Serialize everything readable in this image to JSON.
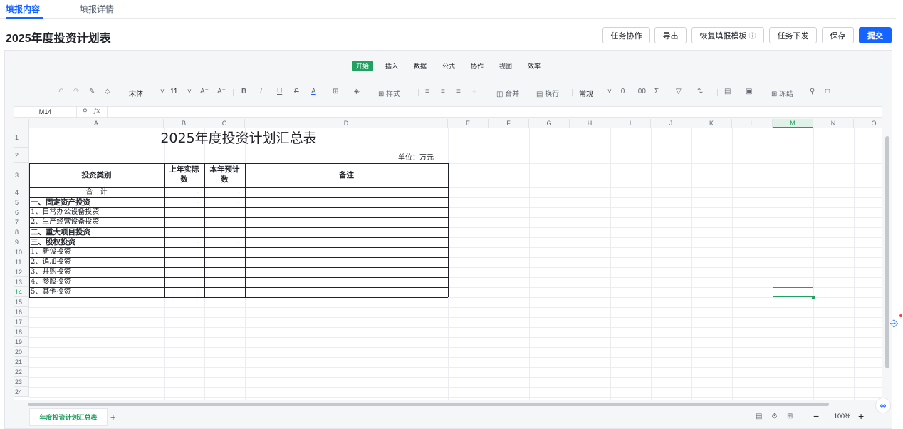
{
  "tabs": [
    {
      "label": "填报内容",
      "active": true
    },
    {
      "label": "填报详情",
      "active": false
    }
  ],
  "page_title": "2025年度投资计划表",
  "header_buttons": {
    "task_collab": "任务协作",
    "export": "导出",
    "restore_template": "恢复填报模板",
    "task_dispatch": "任务下发",
    "save": "保存",
    "submit": "提交"
  },
  "menu_tabs": [
    "开始",
    "插入",
    "数据",
    "公式",
    "协作",
    "视图",
    "效率"
  ],
  "toolbar": {
    "font_name": "宋体",
    "font_size": "11",
    "font_grow": "A⁺",
    "font_shrink": "A⁻",
    "bold": "B",
    "italic": "I",
    "underline": "U",
    "strike": "S",
    "style": "样式",
    "merge": "合并",
    "wrap": "换行",
    "number_format": "常规",
    "freeze": "冻结",
    "font_color": "A"
  },
  "name_box": "M14",
  "formula_icon": "fx",
  "columns": [
    "A",
    "B",
    "C",
    "D",
    "E",
    "F",
    "G",
    "H",
    "I",
    "J",
    "K",
    "L",
    "M",
    "N",
    "O"
  ],
  "selected_column": "M",
  "rows": [
    "1",
    "2",
    "3",
    "4",
    "5",
    "6",
    "7",
    "8",
    "9",
    "10",
    "11",
    "12",
    "13",
    "14",
    "15",
    "16",
    "17",
    "18",
    "19",
    "20",
    "21",
    "22",
    "23",
    "24"
  ],
  "selected_row": "14",
  "sheet": {
    "title": "2025年度投资计划汇总表",
    "unit": "单位：万元",
    "header": {
      "category": "投资类别",
      "prev_year_line1": "上年实际",
      "prev_year_line2": "数",
      "this_year_line1": "本年预计",
      "this_year_line2": "数",
      "note": "备注"
    },
    "total_label": "合　计",
    "items": [
      {
        "label": "一、固定资产投资",
        "bold": true,
        "dash": true
      },
      {
        "label": "1、日常办公设备投资",
        "bold": false,
        "dash": false
      },
      {
        "label": "2、生产经营设备投资",
        "bold": false,
        "dash": false
      },
      {
        "label": "二、重大项目投资",
        "bold": true,
        "dash": false
      },
      {
        "label": "三、股权投资",
        "bold": true,
        "dash": true
      },
      {
        "label": "1、新设投资",
        "bold": false,
        "dash": false
      },
      {
        "label": "2、追加投资",
        "bold": false,
        "dash": false
      },
      {
        "label": "3、并购投资",
        "bold": false,
        "dash": false
      },
      {
        "label": "4、参股投资",
        "bold": false,
        "dash": false
      },
      {
        "label": "5、其他投资",
        "bold": false,
        "dash": false
      }
    ],
    "dash_value": "-"
  },
  "sheet_tab": "年度投资计划汇总表",
  "add_sheet": "+",
  "zoom": "100%",
  "zoom_minus": "−",
  "zoom_plus": "+"
}
